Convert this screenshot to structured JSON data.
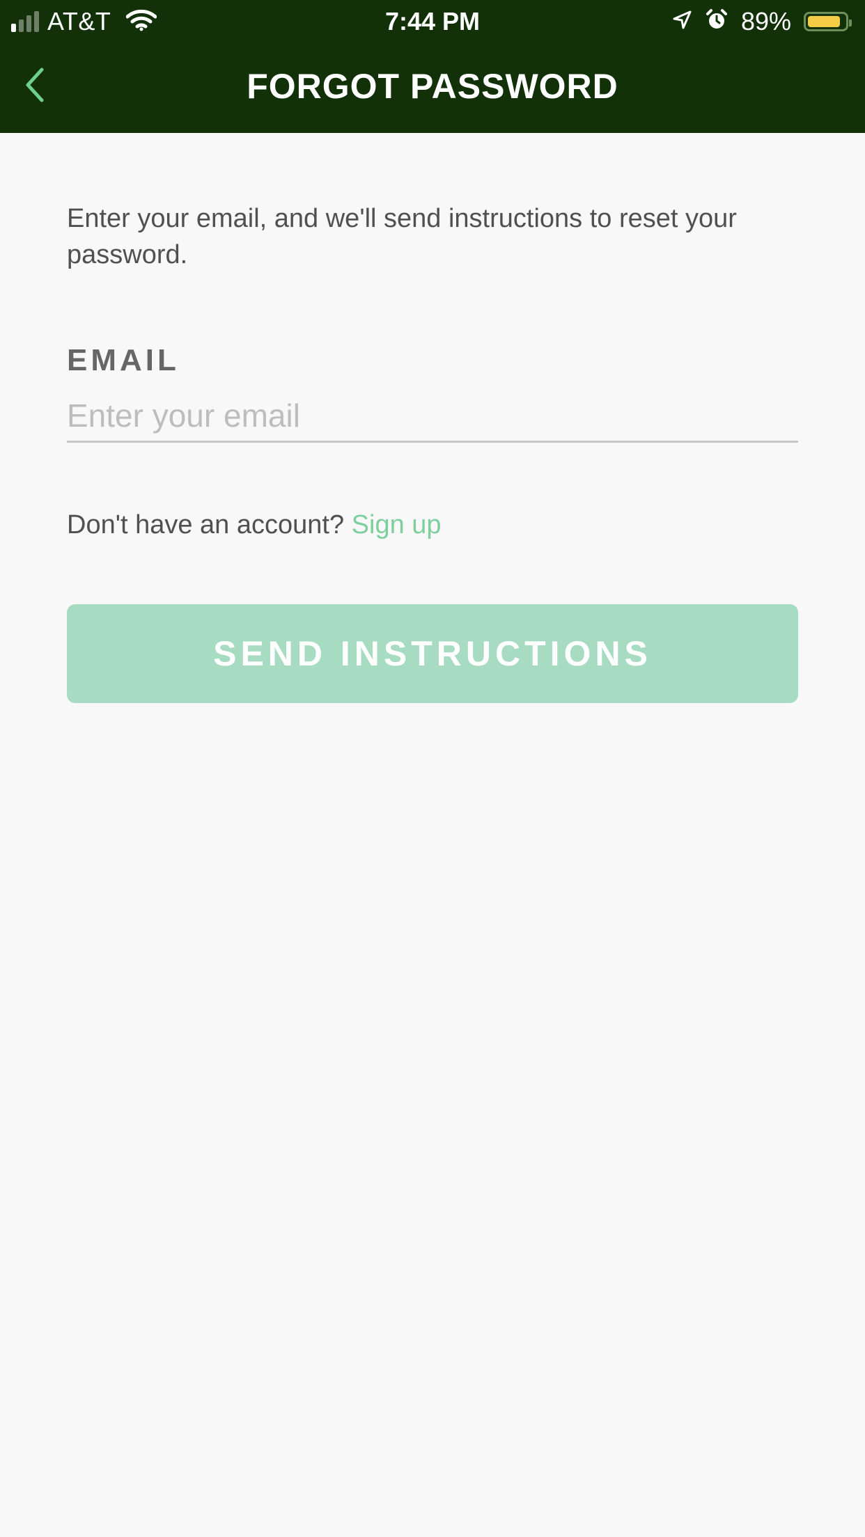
{
  "status_bar": {
    "carrier": "AT&T",
    "time": "7:44 PM",
    "battery_percent": "89%",
    "signal_bars_filled": 1,
    "signal_bars_total": 4,
    "battery_level": 0.89,
    "battery_color": "#f5cc45"
  },
  "nav": {
    "title": "FORGOT PASSWORD",
    "back_icon": "chevron-left-icon"
  },
  "form": {
    "intro": "Enter your email, and we'll send instructions to reset your password.",
    "email_label": "EMAIL",
    "email_placeholder": "Enter your email",
    "email_value": "",
    "signup_prompt": "Don't have an account?",
    "signup_link": "Sign up",
    "submit_label": "SEND INSTRUCTIONS"
  },
  "colors": {
    "header_bg": "#123108",
    "accent": "#7fcf9e",
    "button_bg": "#a8dcc2",
    "page_bg": "#f8f8f8"
  }
}
